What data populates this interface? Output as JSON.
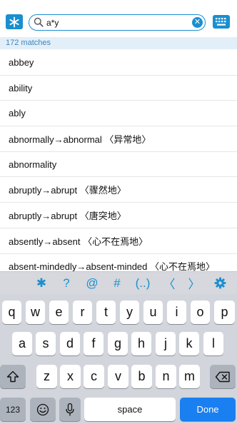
{
  "search": {
    "value": "a*y",
    "placeholder": ""
  },
  "match_count": "172 matches",
  "results": [
    "abbey",
    "ability",
    "ably",
    "abnormally→abnormal 〈异常地〉",
    "abnormality",
    "abruptly→abrupt 〈骤然地〉",
    "abruptly→abrupt 〈唐突地〉",
    "absently→absent 〈心不在焉地〉",
    "absent-mindedly→absent-minded 〈心不在焉地〉"
  ],
  "accessory_keys": [
    "✱",
    "?",
    "@",
    "#",
    "(..)",
    "〈",
    "〉"
  ],
  "keyboard": {
    "row1": [
      "q",
      "w",
      "e",
      "r",
      "t",
      "y",
      "u",
      "i",
      "o",
      "p"
    ],
    "row2": [
      "a",
      "s",
      "d",
      "f",
      "g",
      "h",
      "j",
      "k",
      "l"
    ],
    "row3": [
      "z",
      "x",
      "c",
      "v",
      "b",
      "n",
      "m"
    ],
    "numbers_label": "123",
    "space_label": "space",
    "done_label": "Done"
  },
  "colors": {
    "accent": "#1a8fd0",
    "done": "#1a7ff0"
  },
  "icons": [
    "asterisk-icon",
    "search-icon",
    "clear-icon",
    "keyboard-icon",
    "gear-icon",
    "shift-icon",
    "backspace-icon",
    "emoji-icon",
    "microphone-icon"
  ]
}
